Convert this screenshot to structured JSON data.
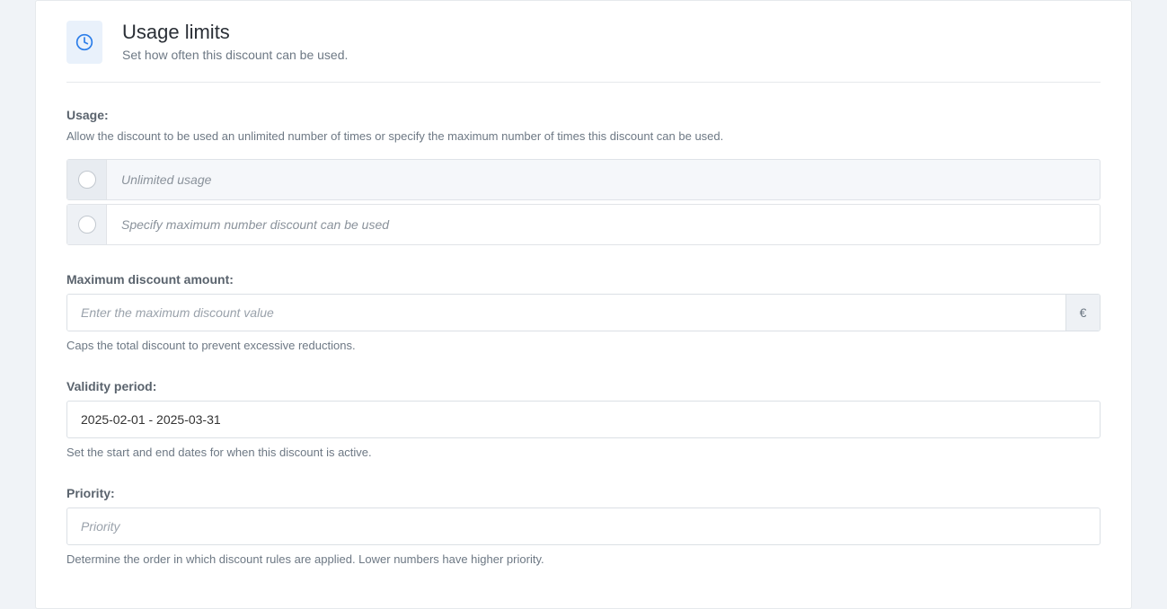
{
  "header": {
    "title": "Usage limits",
    "subtitle": "Set how often this discount can be used."
  },
  "usage": {
    "label": "Usage:",
    "desc": "Allow the discount to be used an unlimited number of times or specify the maximum number of times this discount can be used.",
    "options": {
      "unlimited": "Unlimited usage",
      "specify": "Specify maximum number discount can be used"
    }
  },
  "max_amount": {
    "label": "Maximum discount amount:",
    "placeholder": "Enter the maximum discount value",
    "suffix": "€",
    "help": "Caps the total discount to prevent excessive reductions."
  },
  "validity": {
    "label": "Validity period:",
    "value": "2025-02-01 - 2025-03-31",
    "help": "Set the start and end dates for when this discount is active."
  },
  "priority": {
    "label": "Priority:",
    "placeholder": "Priority",
    "help": "Determine the order in which discount rules are applied. Lower numbers have higher priority."
  }
}
